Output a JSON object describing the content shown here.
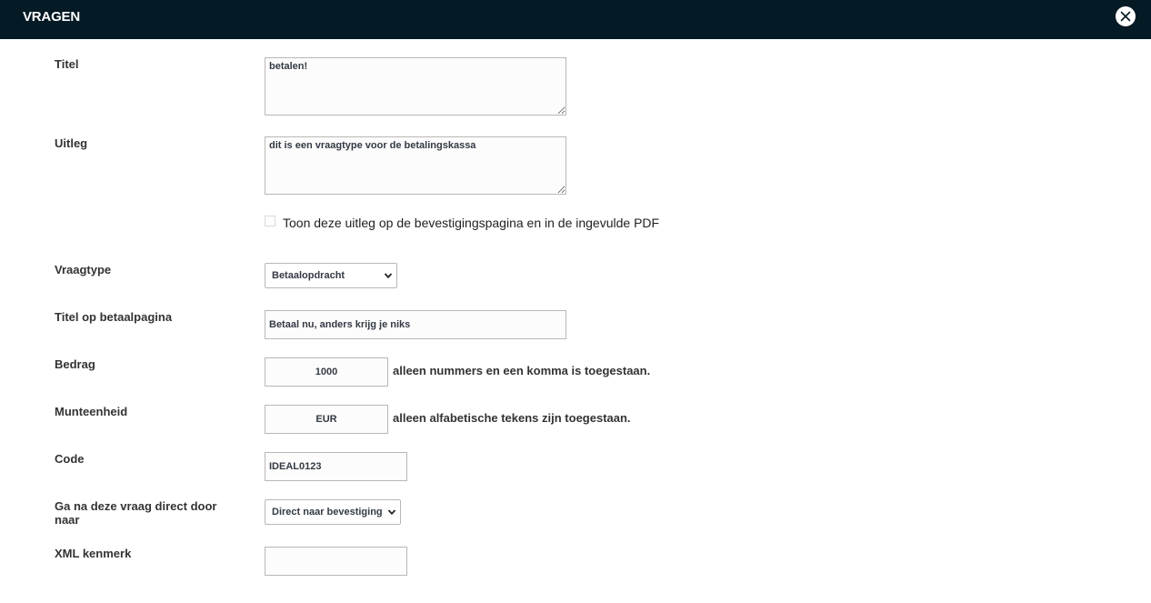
{
  "header": {
    "title": "VRAGEN"
  },
  "form": {
    "titel": {
      "label": "Titel",
      "value": "betalen!"
    },
    "uitleg": {
      "label": "Uitleg",
      "value": "dit is een vraagtype voor de betalingskassa"
    },
    "toon_uitleg": {
      "label": "Toon deze uitleg op de bevestigingspagina en in de ingevulde PDF",
      "checked": false
    },
    "vraagtype": {
      "label": "Vraagtype",
      "selected": "Betaalopdracht"
    },
    "titel_betaalpagina": {
      "label": "Titel op betaalpagina",
      "value": "Betaal nu, anders krijg je niks"
    },
    "bedrag": {
      "label": "Bedrag",
      "value": "1000",
      "hint": "alleen nummers en een komma is toegestaan."
    },
    "munteenheid": {
      "label": "Munteenheid",
      "value": "EUR",
      "hint": "alleen alfabetische tekens zijn toegestaan."
    },
    "code": {
      "label": "Code",
      "value": "IDEAL0123"
    },
    "doorgaan": {
      "label": "Ga na deze vraag direct door naar",
      "selected": "Direct naar bevestiging"
    },
    "xml_kenmerk": {
      "label": "XML kenmerk",
      "value": ""
    }
  },
  "icons": {
    "close": "close-icon",
    "dropdown": "chevron-down-icon"
  },
  "colors": {
    "header_bg": "#041a24",
    "text": "#333333"
  }
}
